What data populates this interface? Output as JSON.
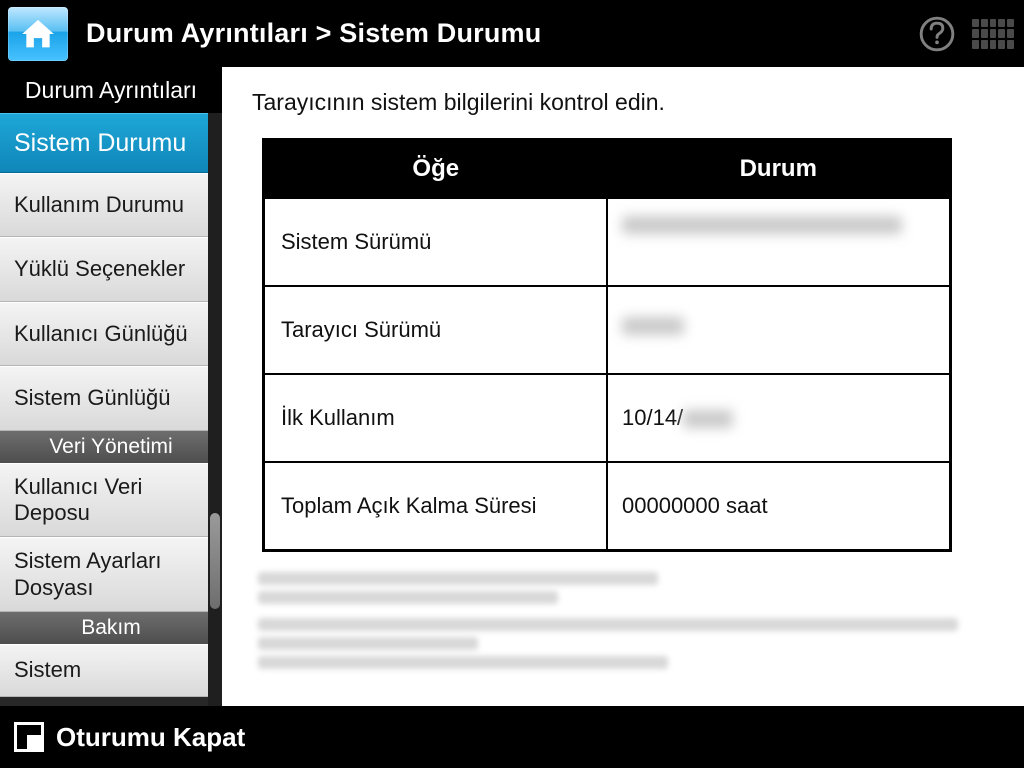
{
  "header": {
    "breadcrumb": "Durum Ayrıntıları > Sistem Durumu"
  },
  "sidebar": {
    "title": "Durum Ayrıntıları",
    "items": [
      {
        "label": "Sistem Durumu",
        "active": true
      },
      {
        "label": "Kullanım Durumu"
      },
      {
        "label": "Yüklü Seçenekler"
      },
      {
        "label": "Kullanıcı Günlüğü"
      },
      {
        "label": "Sistem Günlüğü"
      }
    ],
    "section1": "Veri Yönetimi",
    "items2": [
      {
        "label": "Kullanıcı Veri Deposu"
      },
      {
        "label": "Sistem Ayarları Dosyası"
      }
    ],
    "section2": "Bakım",
    "items3": [
      {
        "label": "Sistem"
      }
    ]
  },
  "main": {
    "instruction": "Tarayıcının sistem bilgilerini kontrol edin.",
    "col1": "Öğe",
    "col2": "Durum",
    "rows": [
      {
        "item": "Sistem Sürümü",
        "status": "na001 01.01.01.0045 541 01",
        "blurred": true
      },
      {
        "item": "Tarayıcı Sürümü",
        "status": "0100",
        "blurred": true
      },
      {
        "item": "İlk Kullanım",
        "status_prefix": "10/14/",
        "status_suffix": "0716",
        "partial_blur": true
      },
      {
        "item": "Toplam Açık Kalma Süresi",
        "status": "00000000 saat"
      }
    ]
  },
  "footer": {
    "logout": "Oturumu Kapat"
  }
}
